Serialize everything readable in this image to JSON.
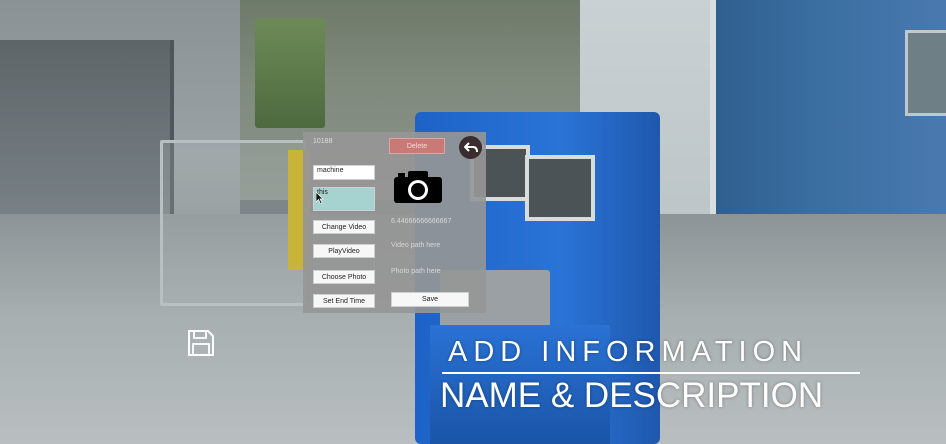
{
  "panel": {
    "id_text": "10188",
    "delete_label": "Delete",
    "name_value": "machine",
    "description_value": "this",
    "change_video_label": "Change Video",
    "play_video_label": "PlayVideo",
    "choose_photo_label": "Choose Photo",
    "set_end_time_label": "Set End Time",
    "number_value": "6.44666666666667",
    "video_path_text": "Video path here",
    "photo_path_text": "Photo path here",
    "save_label": "Save"
  },
  "overlay": {
    "caption_line1": "ADD INFORMATION",
    "caption_line2": "NAME & DESCRIPTION"
  },
  "icons": {
    "camera": "camera-icon",
    "back": "back-arrow-icon",
    "floppy": "floppy-disk-icon",
    "cursor": "mouse-cursor-icon"
  },
  "colors": {
    "delete_button": "#c97a76",
    "description_field": "#a6d3cf",
    "back_button": "#3b2c2f"
  }
}
